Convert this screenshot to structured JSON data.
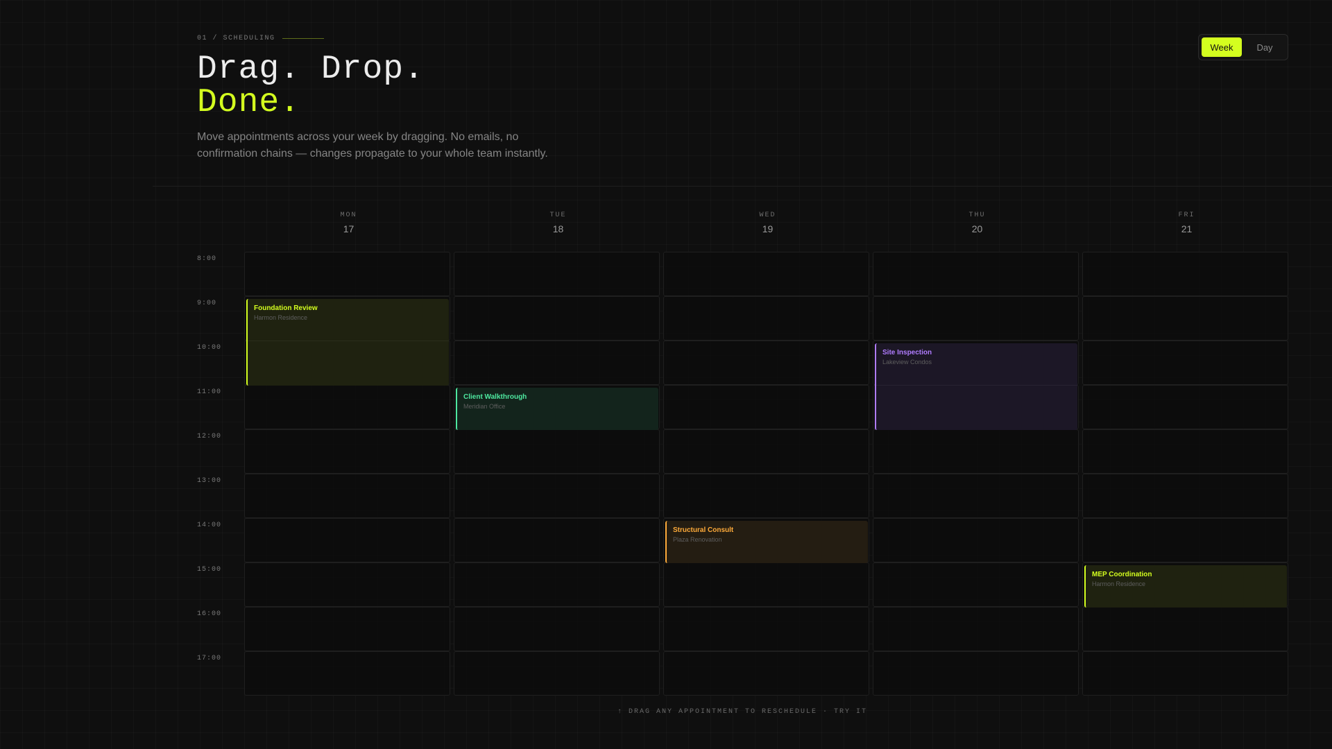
{
  "header": {
    "eyebrow": "01 / SCHEDULING",
    "headline_line1": "Drag. Drop.",
    "headline_line2": "Done.",
    "subtitle": "Move appointments across your week by dragging. No emails, no confirmation chains — changes propagate to your whole team instantly."
  },
  "view_toggle": {
    "options": [
      "Week",
      "Day"
    ],
    "selected": "Week"
  },
  "calendar": {
    "days": [
      {
        "name": "MON",
        "date": "17"
      },
      {
        "name": "TUE",
        "date": "18"
      },
      {
        "name": "WED",
        "date": "19"
      },
      {
        "name": "THU",
        "date": "20"
      },
      {
        "name": "FRI",
        "date": "21"
      }
    ],
    "times": [
      "8:00",
      "9:00",
      "10:00",
      "11:00",
      "12:00",
      "13:00",
      "14:00",
      "15:00",
      "16:00",
      "17:00"
    ],
    "events": [
      {
        "title": "Foundation Review",
        "location": "Harmon Residence",
        "day": "MON",
        "start": "9:00",
        "end": "11:00",
        "color": "#d4ff1f"
      },
      {
        "title": "Client Walkthrough",
        "location": "Meridian Office",
        "day": "TUE",
        "start": "11:00",
        "end": "12:00",
        "color": "#4ee8a0"
      },
      {
        "title": "Site Inspection",
        "location": "Lakeview Condos",
        "day": "THU",
        "start": "10:00",
        "end": "12:00",
        "color": "#b07cff"
      },
      {
        "title": "Structural Consult",
        "location": "Plaza Renovation",
        "day": "WED",
        "start": "14:00",
        "end": "15:00",
        "color": "#ffab3a"
      },
      {
        "title": "MEP Coordination",
        "location": "Harmon Residence",
        "day": "FRI",
        "start": "15:00",
        "end": "16:00",
        "color": "#d4ff1f"
      }
    ]
  },
  "hint": "↑ DRAG ANY APPOINTMENT TO RESCHEDULE · TRY IT"
}
